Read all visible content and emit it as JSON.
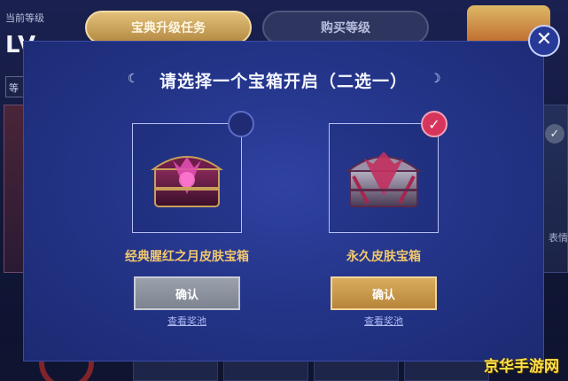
{
  "background": {
    "level_label": "当前等级",
    "level_value": "LV",
    "tabs": [
      {
        "label": "宝典升级任务",
        "active": true
      },
      {
        "label": "购买等级",
        "active": false
      }
    ],
    "left_field": "等",
    "right_text": "表情"
  },
  "modal": {
    "title": "请选择一个宝箱开启（二选一）",
    "chests": [
      {
        "name": "经典腥红之月皮肤宝箱",
        "confirm_label": "确认",
        "pool_link": "查看奖池",
        "selected": false
      },
      {
        "name": "永久皮肤宝箱",
        "confirm_label": "确认",
        "pool_link": "查看奖池",
        "selected": true
      }
    ],
    "close_icon": "close-icon"
  },
  "watermark": "京华手游网",
  "colors": {
    "modal_bg": "#24358a",
    "chest_name": "#f2c86e",
    "button_gold": "#c9974a",
    "button_gray": "#8a909c",
    "check_red": "#d7345c"
  }
}
